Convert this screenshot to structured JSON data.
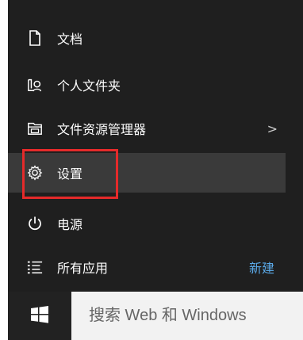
{
  "menu": {
    "items": [
      {
        "id": "documents",
        "label": "文档",
        "icon": "document-icon"
      },
      {
        "id": "personal-folder",
        "label": "个人文件夹",
        "icon": "user-folder-icon"
      },
      {
        "id": "file-explorer",
        "label": "文件资源管理器",
        "icon": "file-explorer-icon",
        "chevron": ">"
      },
      {
        "id": "settings",
        "label": "设置",
        "icon": "gear-icon"
      },
      {
        "id": "power",
        "label": "电源",
        "icon": "power-icon"
      },
      {
        "id": "all-apps",
        "label": "所有应用",
        "icon": "all-apps-icon",
        "action": "新建"
      }
    ]
  },
  "taskbar": {
    "start_icon": "windows-logo-icon",
    "search_placeholder": "搜索 Web 和 Windows"
  },
  "colors": {
    "menu_bg": "#1f1f1f",
    "hover_bg": "#3a3a3a",
    "highlight_border": "#e52a2a",
    "link": "#5aa8e6"
  }
}
